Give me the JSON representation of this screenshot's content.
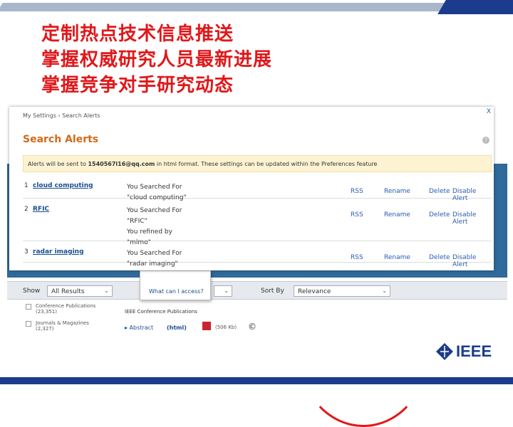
{
  "slide": {
    "headlines": [
      "定制热点技术信息推送",
      "掌握权威研究人员最新进展",
      "掌握竞争对手研究动态"
    ],
    "logo_text": "IEEE"
  },
  "dialog": {
    "close": "X",
    "breadcrumb": "My Settings › Search Alerts",
    "title": "Search Alerts",
    "help": "?",
    "notice_prefix": "Alerts will be sent to ",
    "notice_email": "1540567l16@qq.com",
    "notice_suffix": " in html format. These settings can be updated within the Preferences feature",
    "alerts": [
      {
        "num": "1",
        "name": "cloud computing",
        "lines": [
          "You Searched For",
          "\"cloud computing\""
        ],
        "rss": "RSS",
        "rename": "Rename",
        "delete": "Delete",
        "disable": "Disable Alert"
      },
      {
        "num": "2",
        "name": "RFIC",
        "lines": [
          "You Searched For",
          "\"RFIC\"",
          "You refined by",
          "\"mlmo\""
        ],
        "rss": "RSS",
        "rename": "Rename",
        "delete": "Delete",
        "disable": "Disable Alert"
      },
      {
        "num": "3",
        "name": "radar imaging",
        "lines": [
          "You Searched For",
          "\"radar imaging\""
        ],
        "rss": "RSS",
        "rename": "Rename",
        "delete": "Delete",
        "disable": "Disable Alert"
      }
    ]
  },
  "toolbar": {
    "show_label": "Show",
    "show_value": "All Results",
    "sort_label": "Sort By",
    "sort_value": "Relevance"
  },
  "popup": {
    "link": "What can I access?"
  },
  "results": {
    "facets": [
      {
        "label": "Conference Publications",
        "count": "(23,351)"
      },
      {
        "label": "Journals & Magazines",
        "count": "(2,327)"
      }
    ],
    "publication": "IEEE Conference Publications",
    "abstract": "▸ Abstract",
    "html": "(html)",
    "pdf_size": "(506 Kb)",
    "copyright": "©"
  },
  "colors": {
    "headline": "#e0181b",
    "brand_blue": "#1b3c8d",
    "alert_title": "#d26a17"
  }
}
